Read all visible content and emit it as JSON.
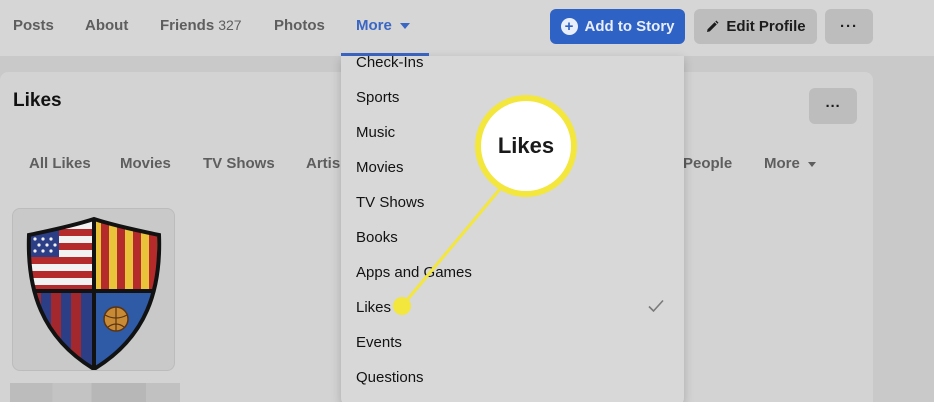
{
  "nav": {
    "tabs": {
      "posts": "Posts",
      "about": "About",
      "friends": "Friends",
      "friends_count": "327",
      "photos": "Photos",
      "more": "More"
    },
    "add_story": "Add to Story",
    "edit_profile": "Edit Profile",
    "overflow": "···"
  },
  "likes_card": {
    "title": "Likes",
    "overflow": "···",
    "filters": {
      "all_likes": "All Likes",
      "movies": "Movies",
      "tv_shows": "TV Shows",
      "artists": "Artis",
      "people": "People",
      "more": "More"
    }
  },
  "more_menu": {
    "items": [
      "Check-Ins",
      "Sports",
      "Music",
      "Movies",
      "TV Shows",
      "Books",
      "Apps and Games",
      "Likes",
      "Events",
      "Questions"
    ],
    "checked_item": "Likes"
  },
  "callout": {
    "label": "Likes",
    "color": "#f3e63c"
  },
  "colors": {
    "accent": "#2f62c5",
    "more_tab": "#3a66c4"
  }
}
